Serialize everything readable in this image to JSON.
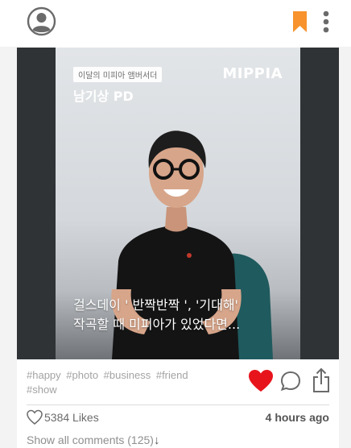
{
  "header": {
    "avatar_icon": "user-avatar-icon",
    "bookmark_icon": "bookmark-icon",
    "bookmark_color": "#f7922c",
    "menu_icon": "more-vertical-icon"
  },
  "post": {
    "image": {
      "badge": "이달의 미피아 앰버서더",
      "name": "남기상 PD",
      "brand": "MIPPIA",
      "caption_line1": "걸스데이 ' 반짝반짝 ', '기대해'",
      "caption_line2": "작곡할 때 미피아가 있었다면..."
    },
    "tags": [
      "#happy",
      "#photo",
      "#business",
      "#friend",
      "#show"
    ],
    "actions": {
      "like_icon": "heart-filled-icon",
      "like_color": "#e8141c",
      "comment_icon": "comment-bubble-icon",
      "share_icon": "share-icon"
    },
    "likes_count": "5384 Likes",
    "time": "4 hours ago",
    "show_comments": "Show all comments (125)",
    "comments_arrow": "↓"
  }
}
